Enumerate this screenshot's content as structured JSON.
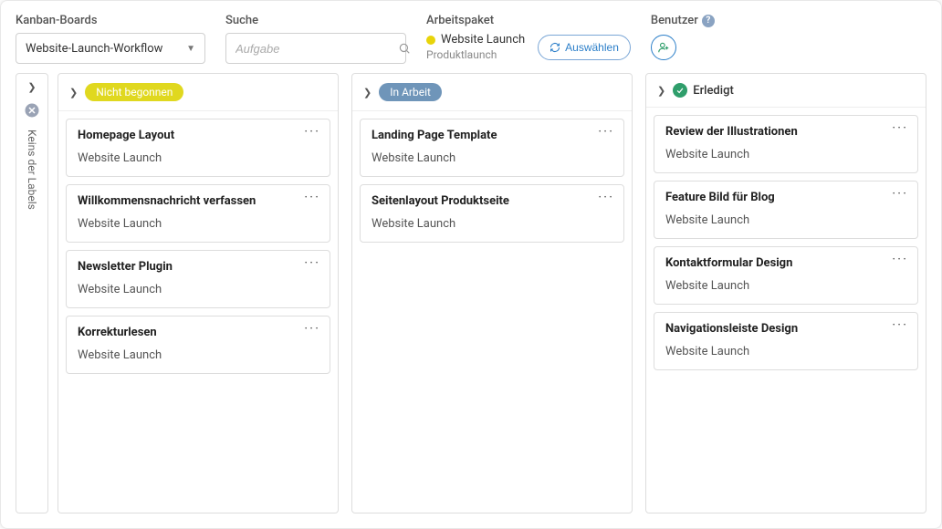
{
  "header": {
    "boards_label": "Kanban-Boards",
    "boards_value": "Website-Launch-Workflow",
    "search_label": "Suche",
    "search_placeholder": "Aufgabe",
    "arbeitspaket_label": "Arbeitspaket",
    "arbeitspaket_name": "Website Launch",
    "arbeitspaket_sub": "Produktlaunch",
    "auswaehlen_label": "Auswählen",
    "benutzer_label": "Benutzer"
  },
  "sidebar": {
    "label": "Keins der Labels"
  },
  "columns": [
    {
      "kind": "pill",
      "label": "Nicht begonnen",
      "color": "yellow",
      "cards": [
        {
          "title": "Homepage Layout",
          "sub": "Website Launch"
        },
        {
          "title": "Willkommensnachricht verfassen",
          "sub": "Website Launch"
        },
        {
          "title": "Newsletter Plugin",
          "sub": "Website Launch"
        },
        {
          "title": "Korrekturlesen",
          "sub": "Website Launch"
        }
      ]
    },
    {
      "kind": "pill",
      "label": "In Arbeit",
      "color": "blue",
      "cards": [
        {
          "title": "Landing Page Template",
          "sub": "Website Launch"
        },
        {
          "title": "Seitenlayout Produktseite",
          "sub": "Website Launch"
        }
      ]
    },
    {
      "kind": "done",
      "label": "Erledigt",
      "cards": [
        {
          "title": "Review der Illustrationen",
          "sub": "Website Launch"
        },
        {
          "title": "Feature Bild für Blog",
          "sub": "Website Launch"
        },
        {
          "title": "Kontaktformular Design",
          "sub": "Website Launch"
        },
        {
          "title": "Navigationsleiste Design",
          "sub": "Website Launch"
        }
      ]
    }
  ]
}
